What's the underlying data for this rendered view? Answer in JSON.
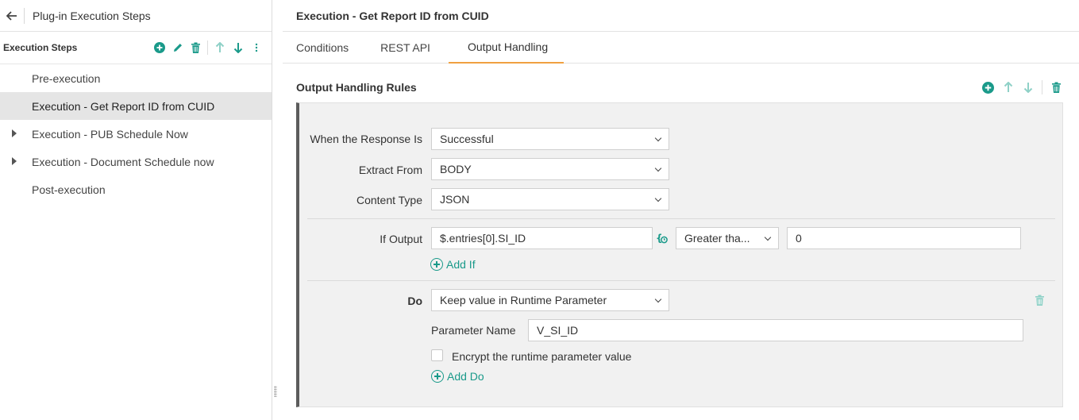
{
  "left_panel": {
    "title": "Plug-in Execution Steps",
    "steps_header": "Execution Steps",
    "steps": [
      {
        "label": "Pre-execution",
        "expandable": false,
        "selected": false
      },
      {
        "label": "Execution - Get Report ID from CUID",
        "expandable": false,
        "selected": true
      },
      {
        "label": "Execution - PUB Schedule Now",
        "expandable": true,
        "selected": false
      },
      {
        "label": "Execution - Document Schedule now",
        "expandable": true,
        "selected": false
      },
      {
        "label": "Post-execution",
        "expandable": false,
        "selected": false
      }
    ]
  },
  "main": {
    "title": "Execution - Get Report ID from CUID",
    "tabs": [
      {
        "label": "Conditions",
        "active": false
      },
      {
        "label": "REST API",
        "active": false
      },
      {
        "label": "Output Handling",
        "active": true
      }
    ],
    "section_title": "Output Handling Rules",
    "rule": {
      "response_label": "When the Response Is",
      "response_value": "Successful",
      "extract_label": "Extract From",
      "extract_value": "BODY",
      "content_type_label": "Content Type",
      "content_type_value": "JSON",
      "if_output_label": "If Output",
      "if_output_value": "$.entries[0].SI_ID",
      "operator_value": "Greater tha...",
      "compare_value": "0",
      "add_if_label": "Add If",
      "do_label": "Do",
      "do_value": "Keep value in Runtime Parameter",
      "param_name_label": "Parameter Name",
      "param_name_value": "V_SI_ID",
      "encrypt_label": "Encrypt the runtime parameter value",
      "encrypt_checked": false,
      "add_do_label": "Add Do"
    }
  },
  "colors": {
    "accent": "#1a9a8a",
    "accent_light": "#8fd1c7",
    "tab_underline": "#f0a040",
    "selected_row": "#e5e5e5",
    "rule_border": "#5c5c5c"
  }
}
